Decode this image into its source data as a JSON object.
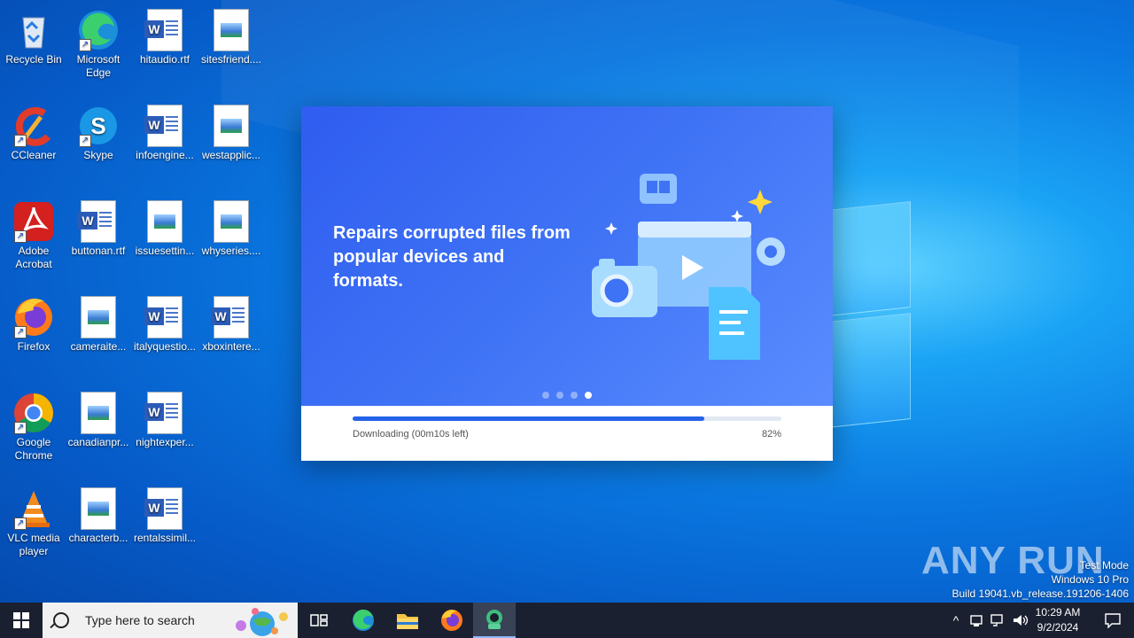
{
  "desktop": {
    "icons": [
      {
        "label": "Recycle Bin",
        "icon": "recycle-bin-icon"
      },
      {
        "label": "Microsoft Edge",
        "icon": "edge-icon"
      },
      {
        "label": "hitaudio.rtf",
        "icon": "word-doc-icon"
      },
      {
        "label": "sitesfriend....",
        "icon": "image-file-icon"
      },
      {
        "label": "CCleaner",
        "icon": "ccleaner-icon"
      },
      {
        "label": "Skype",
        "icon": "skype-icon"
      },
      {
        "label": "infoengine...",
        "icon": "word-doc-icon"
      },
      {
        "label": "westapplic...",
        "icon": "image-file-icon"
      },
      {
        "label": "Adobe Acrobat",
        "icon": "acrobat-icon"
      },
      {
        "label": "buttonan.rtf",
        "icon": "word-doc-icon"
      },
      {
        "label": "issuesettin...",
        "icon": "image-file-icon"
      },
      {
        "label": "whyseries....",
        "icon": "image-file-icon"
      },
      {
        "label": "Firefox",
        "icon": "firefox-icon"
      },
      {
        "label": "cameraite...",
        "icon": "image-file-icon"
      },
      {
        "label": "italyquestio...",
        "icon": "word-doc-icon"
      },
      {
        "label": "xboxintere...",
        "icon": "word-doc-icon"
      },
      {
        "label": "Google Chrome",
        "icon": "chrome-icon"
      },
      {
        "label": "canadianpr...",
        "icon": "image-file-icon"
      },
      {
        "label": "nightexper...",
        "icon": "word-doc-icon"
      },
      {
        "label": "VLC media player",
        "icon": "vlc-icon"
      },
      {
        "label": "characterb...",
        "icon": "image-file-icon"
      },
      {
        "label": "rentalssimil...",
        "icon": "word-doc-icon"
      }
    ]
  },
  "installer": {
    "headline": "Repairs corrupted files from popular devices and formats.",
    "slides_total": 4,
    "slide_active": 4,
    "status": "Downloading (00m10s left)",
    "percent_label": "82%",
    "progress": 0.82,
    "accent": "#2563e8"
  },
  "watermark": {
    "text": "ANY RUN"
  },
  "system": {
    "line1": "Test Mode",
    "line2": "Windows 10 Pro",
    "line3": "Build 19041.vb_release.191206-1406"
  },
  "taskbar": {
    "search_placeholder": "Type here to search",
    "time": "10:29 AM",
    "date": "9/2/2024"
  }
}
